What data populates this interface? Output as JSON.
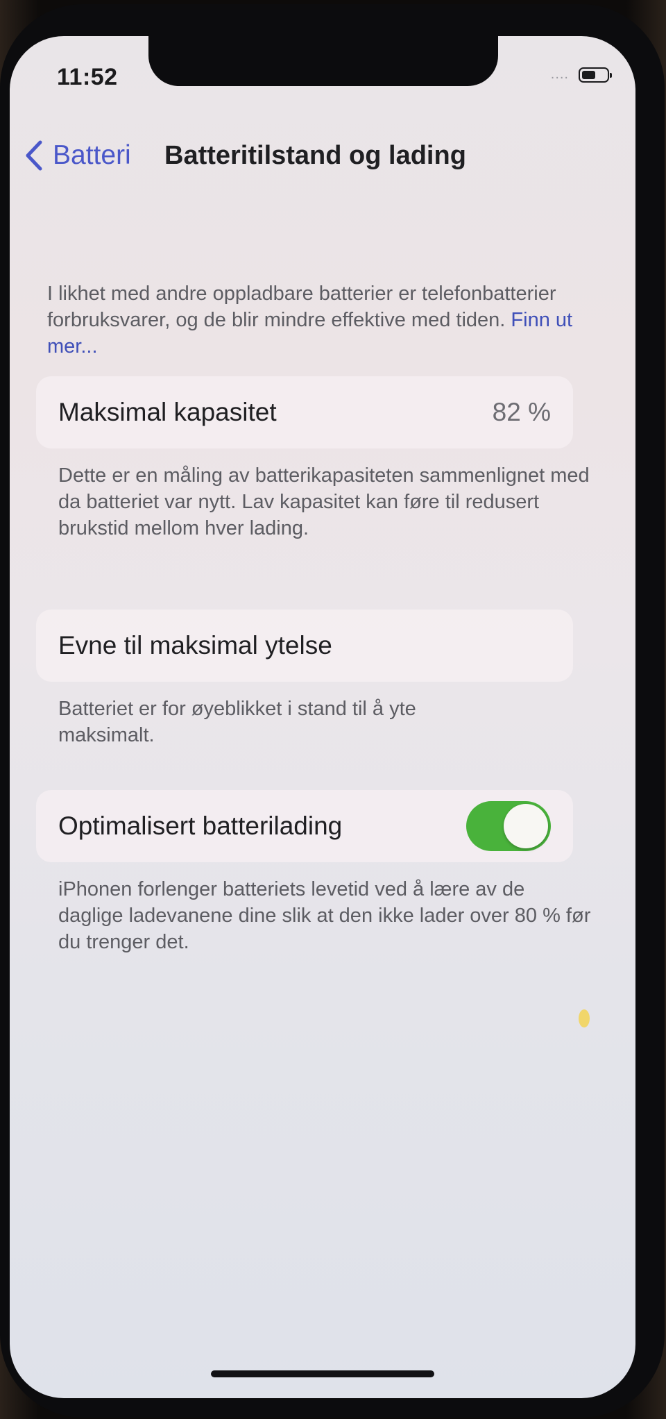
{
  "status_bar": {
    "time": "11:52",
    "signal": "....",
    "battery_level": 0.55
  },
  "nav": {
    "back_label": "Batteri",
    "title": "Batteritilstand og lading"
  },
  "intro": {
    "text": "I likhet med andre oppladbare batterier er telefonbatterier forbruksvarer, og de blir mindre effektive med tiden. ",
    "link": "Finn ut mer..."
  },
  "capacity": {
    "label": "Maksimal kapasitet",
    "value": "82 %",
    "note": "Dette er en måling av batterikapasiteten sammenlignet med da batteriet var nytt. Lav kapasitet kan føre til redusert brukstid mellom hver lading."
  },
  "performance": {
    "label": "Evne til maksimal ytelse",
    "note": "Batteriet er for øyeblikket i stand til å yte maksimalt."
  },
  "optimized": {
    "label": "Optimalisert batterilading",
    "enabled": true,
    "note": "iPhonen forlenger batteriets levetid ved å lære av de daglige ladevanene dine slik at den ikke lader over 80 % før du trenger det."
  },
  "colors": {
    "accent": "#4a57c9",
    "toggle_on": "#49b23b"
  },
  "icons": {
    "back": "chevron-left-icon",
    "battery": "battery-icon"
  }
}
